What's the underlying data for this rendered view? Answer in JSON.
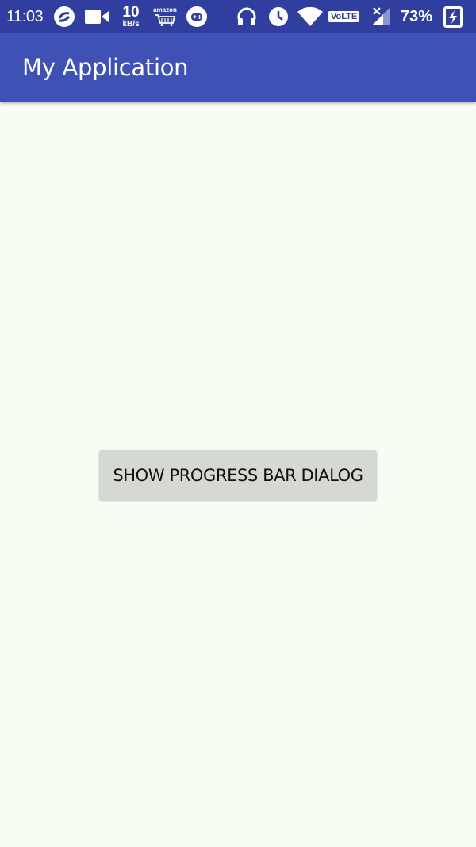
{
  "status_bar": {
    "time": "11:03",
    "net_speed_value": "10",
    "net_speed_unit": "kB/s",
    "amazon_label": "amazon",
    "network_type": "VoLTE",
    "battery_percent": "73%",
    "icons": [
      "jio-icon",
      "video-camera-icon",
      "amazon-cart-icon",
      "game-controller-icon",
      "headphones-icon",
      "alarm-clock-icon",
      "wifi-icon",
      "volte-badge",
      "signal-icon",
      "battery-charging-icon"
    ]
  },
  "app_bar": {
    "title": "My Application"
  },
  "main": {
    "button_label": "SHOW PROGRESS BAR DIALOG"
  },
  "colors": {
    "status_bar": "#303f9f",
    "app_bar": "#3f51b5",
    "background": "#f8fdf4",
    "button": "#d6d8d3"
  }
}
